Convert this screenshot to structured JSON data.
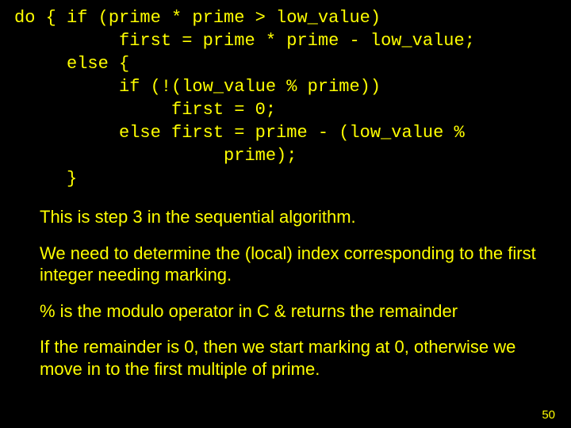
{
  "code": {
    "l1": "do { if (prime * prime > low_value)",
    "l2": "          first = prime * prime - low_value;",
    "l3": "     else {",
    "l4": "          if (!(low_value % prime))",
    "l5": "               first = 0;",
    "l6": "          else first = prime - (low_value %",
    "l7": "                    prime);",
    "l8": "     }"
  },
  "text": {
    "p1": "This is step 3 in the sequential algorithm.",
    "p2": "We need to determine the (local) index corresponding to the first integer needing marking.",
    "p3": "% is the modulo operator in C & returns the remainder",
    "p4": "If the remainder is 0, then we start marking at 0, otherwise we move in to the first multiple of prime."
  },
  "page": "50"
}
